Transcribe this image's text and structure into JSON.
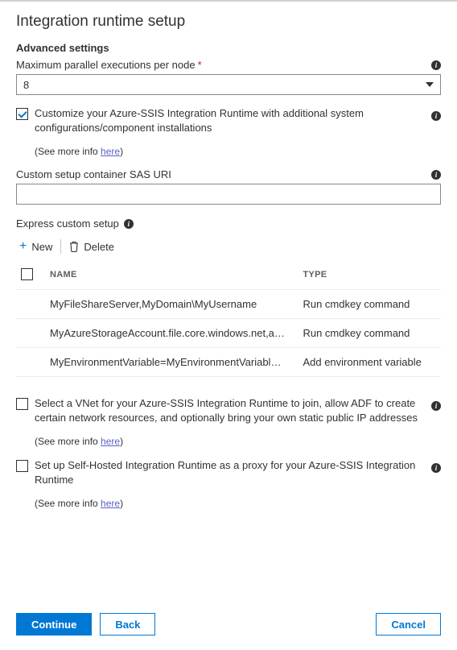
{
  "title": "Integration runtime setup",
  "sectionHeading": "Advanced settings",
  "maxParallel": {
    "label": "Maximum parallel executions per node",
    "required": "*",
    "value": "8"
  },
  "customize": {
    "text": "Customize your Azure-SSIS Integration Runtime with additional system configurations/component installations",
    "moreInfoPrefix": "(See more info ",
    "hereLabel": "here",
    "moreInfoSuffix": ")"
  },
  "sasUri": {
    "label": "Custom setup container SAS URI",
    "value": ""
  },
  "expressLabel": "Express custom setup",
  "cmd": {
    "new": "New",
    "delete": "Delete"
  },
  "table": {
    "headers": {
      "name": "Name",
      "type": "Type"
    },
    "rows": [
      {
        "name": "MyFileShareServer,MyDomain\\MyUsername",
        "type": "Run cmdkey command"
      },
      {
        "name": "MyAzureStorageAccount.file.core.windows.net,azu...",
        "type": "Run cmdkey command"
      },
      {
        "name": "MyEnvironmentVariable=MyEnvironmentVariableValu...",
        "type": "Add environment variable"
      }
    ]
  },
  "vnet": {
    "text": "Select a VNet for your Azure-SSIS Integration Runtime to join, allow ADF to create certain network resources, and optionally bring your own static public IP addresses",
    "moreInfoPrefix": "(See more info ",
    "hereLabel": "here",
    "moreInfoSuffix": ")"
  },
  "proxy": {
    "text": "Set up Self-Hosted Integration Runtime as a proxy for your Azure-SSIS Integration Runtime",
    "moreInfoPrefix": "(See more info ",
    "hereLabel": "here",
    "moreInfoSuffix": ")"
  },
  "buttons": {
    "continue": "Continue",
    "back": "Back",
    "cancel": "Cancel"
  }
}
